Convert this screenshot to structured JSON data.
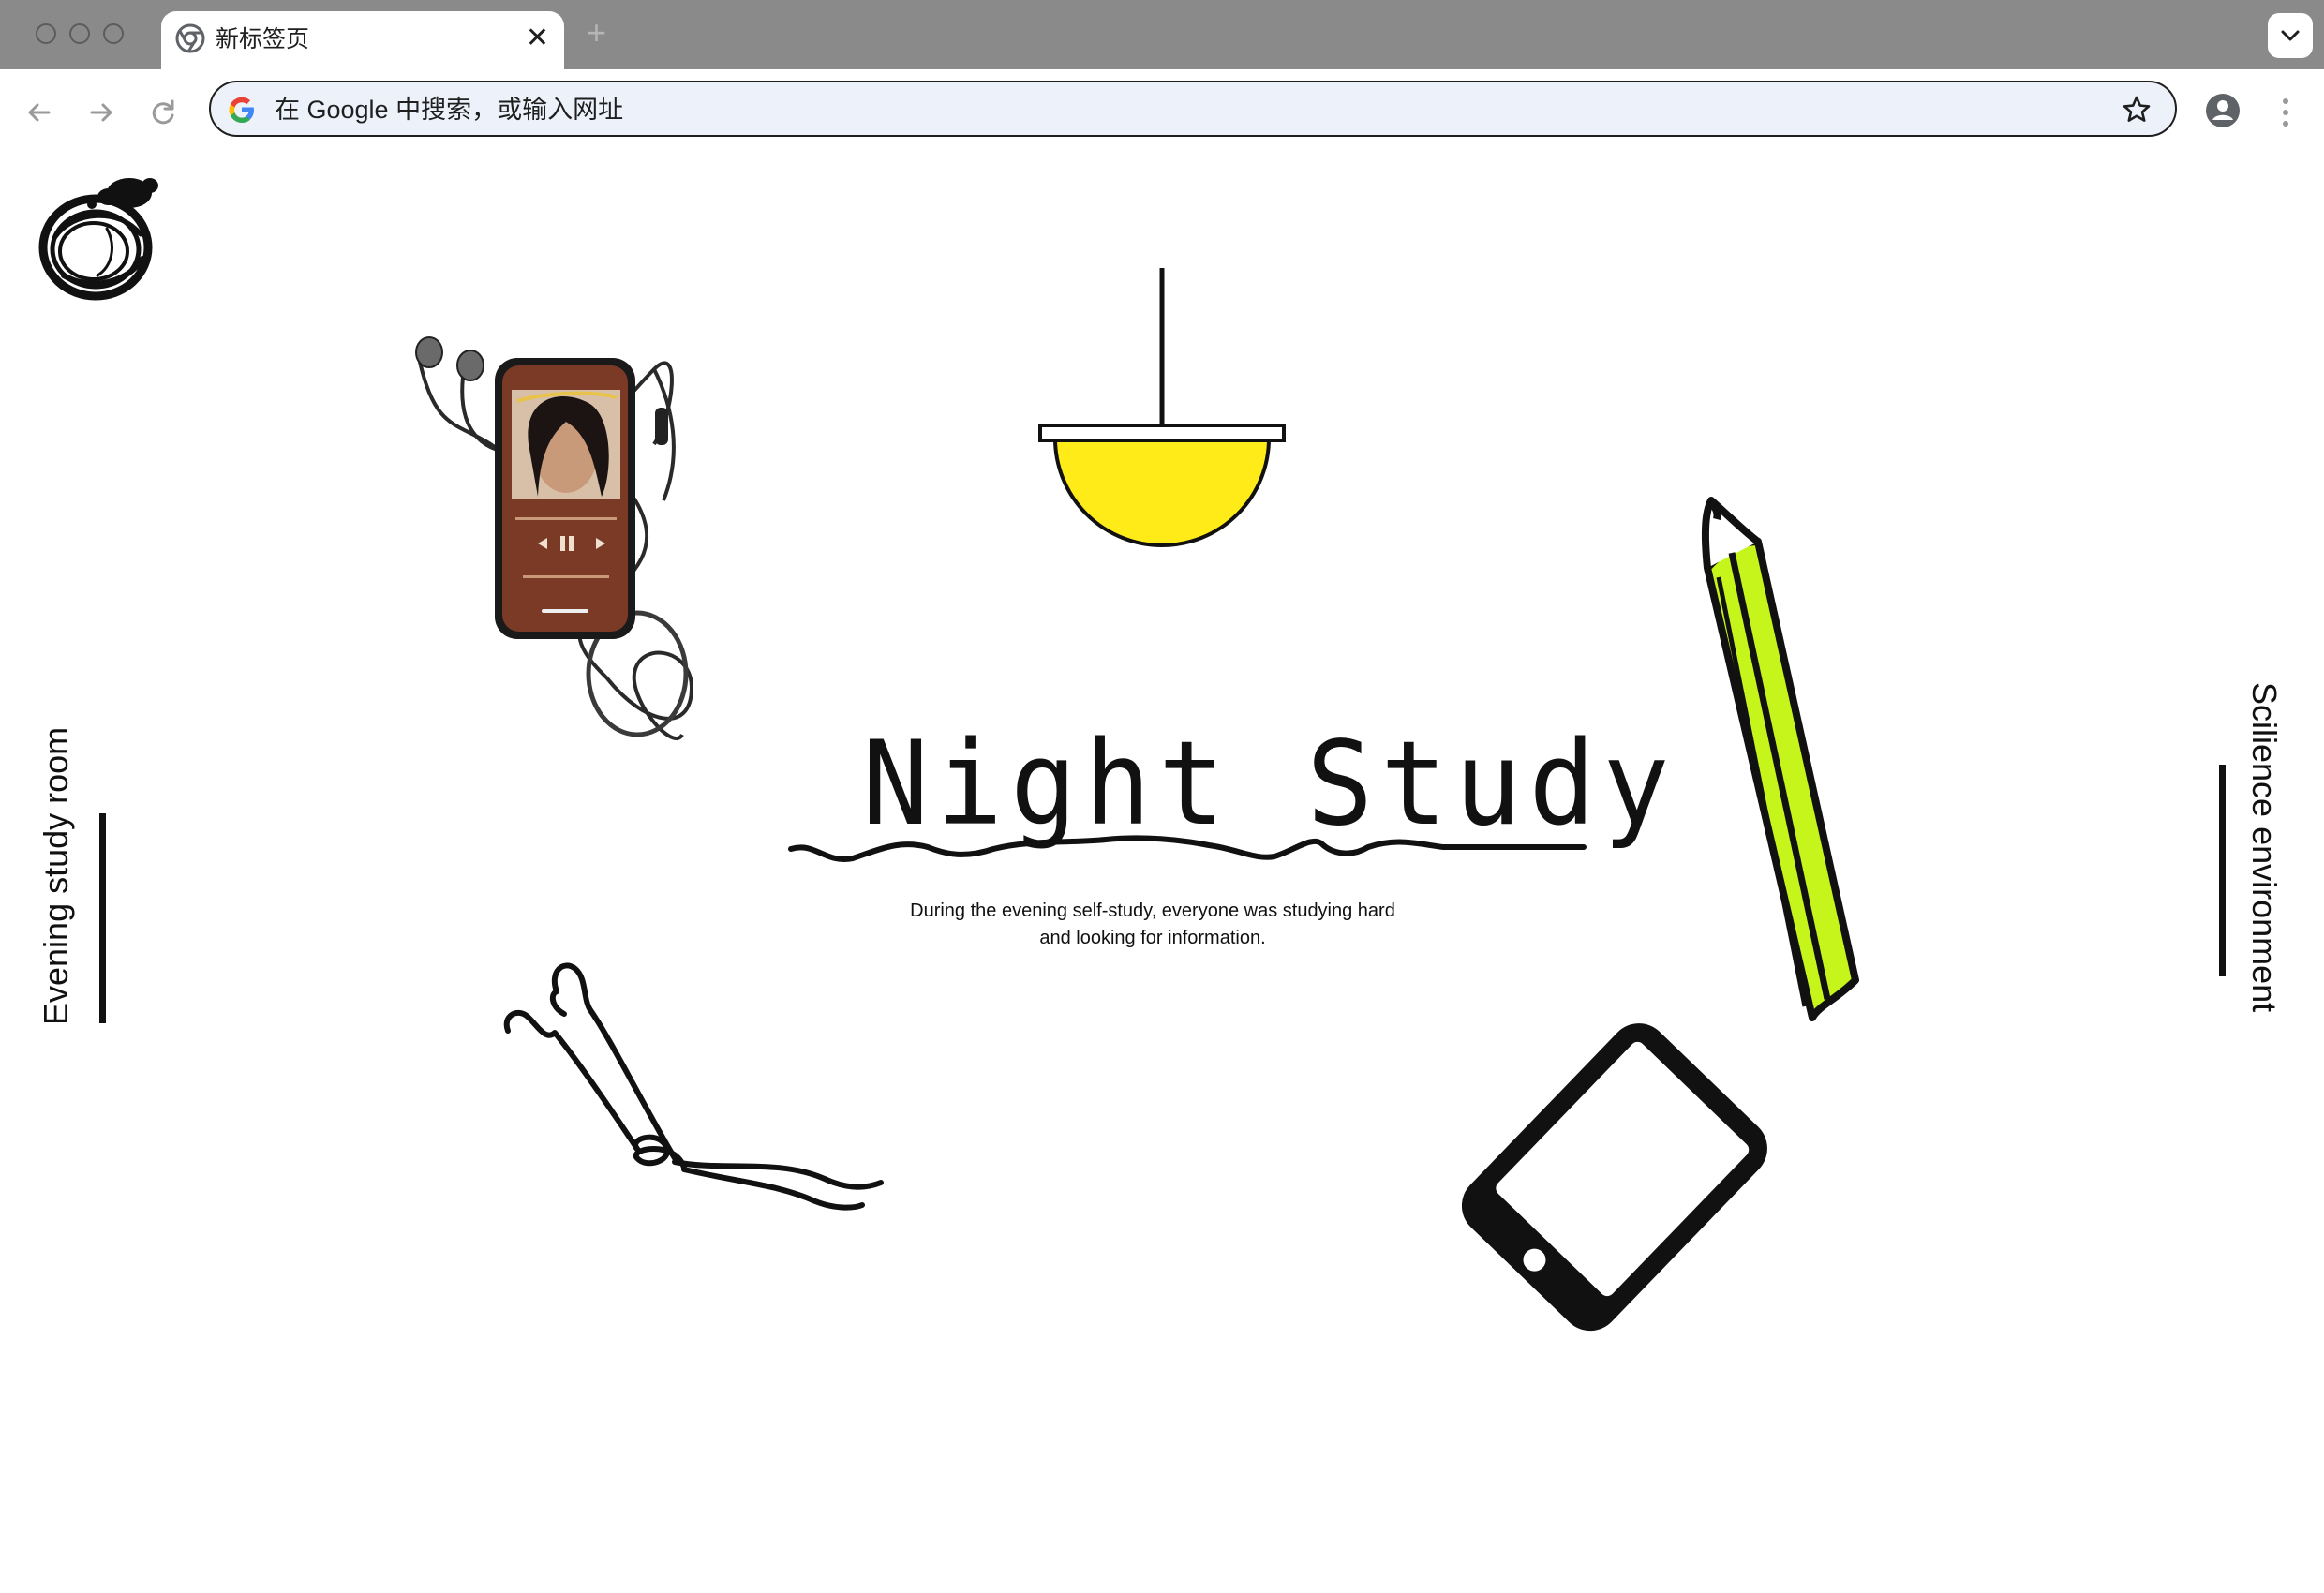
{
  "browser": {
    "tab_title": "新标签页",
    "tab_close_glyph": "✕",
    "new_tab_glyph": "+",
    "omnibox_placeholder": "在 Google 中搜索，或输入网址",
    "icons": [
      "chrome-icon",
      "google-g-icon",
      "back-arrow-icon",
      "forward-arrow-icon",
      "reload-icon",
      "bookmark-star-icon",
      "profile-icon",
      "more-vert-icon",
      "chevron-down-icon"
    ]
  },
  "page": {
    "title": "Night Study",
    "description_line1": "During the evening self-study, everyone was studying hard",
    "description_line2": "and looking for information.",
    "side_left_label": "Evening study room",
    "side_right_label": "Scilience environment",
    "colors": {
      "lamp_shade": "#ffeb17",
      "pencil_body": "#c6f51b",
      "ink": "#111111",
      "chrome_tabbar": "#8a8a8a",
      "omnibox_bg": "#edf2fa"
    },
    "illustrations": [
      "ink-scribble-logo",
      "phone-earphones-photo",
      "hanging-lamp",
      "pencil-sketch",
      "earbuds-sketch",
      "phone-sketch"
    ]
  }
}
